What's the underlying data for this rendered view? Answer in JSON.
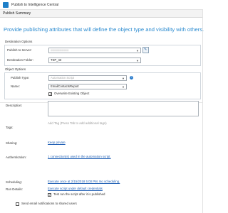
{
  "window": {
    "title": "Publish to Intelligence Central",
    "tab": "Publish Summary",
    "app_icon": "app-logo-icon"
  },
  "banner": "Provide publishing attributes that will define the object type and visibility with others.",
  "destination": {
    "group_label": "Destination Options",
    "server_label": "Publish to Server:",
    "server_value": "●●●●●●●●●●",
    "server_button_icon": "edit-server-icon",
    "folder_label": "Destination Folder:",
    "folder_value": "TSP_43"
  },
  "object": {
    "group_label": "Object Options",
    "type_label": "Publish Type:",
    "type_value": "Automation Script",
    "name_label": "Name:",
    "name_value": "EmailContactsReport",
    "overwrite_label": "Overwrite Existing Object",
    "overwrite_checked": true
  },
  "description": {
    "label": "Description:",
    "value": ""
  },
  "tags": {
    "label": "Tags:",
    "placeholder": "Add Tag (Press Tab to add additional tags)"
  },
  "sharing": {
    "label": "Sharing:",
    "link": "Keep private"
  },
  "authentication": {
    "label": "Authentication:",
    "link": "1 connection(s) used in the automation script."
  },
  "scheduling": {
    "label": "Scheduling:",
    "link": "Execute once at 2/15/2018 5:00 PM. No scheduling."
  },
  "run_details": {
    "label": "Run Details:",
    "link": "Execute script under default credentials",
    "test_run_label": "Test run the script after it is published",
    "test_run_checked": true
  },
  "notify": {
    "label": "Send email notifications to shared users",
    "checked": false
  },
  "colors": {
    "accent": "#2b8bd0",
    "link": "#1f5fb4",
    "help": "#2b7ccc"
  }
}
